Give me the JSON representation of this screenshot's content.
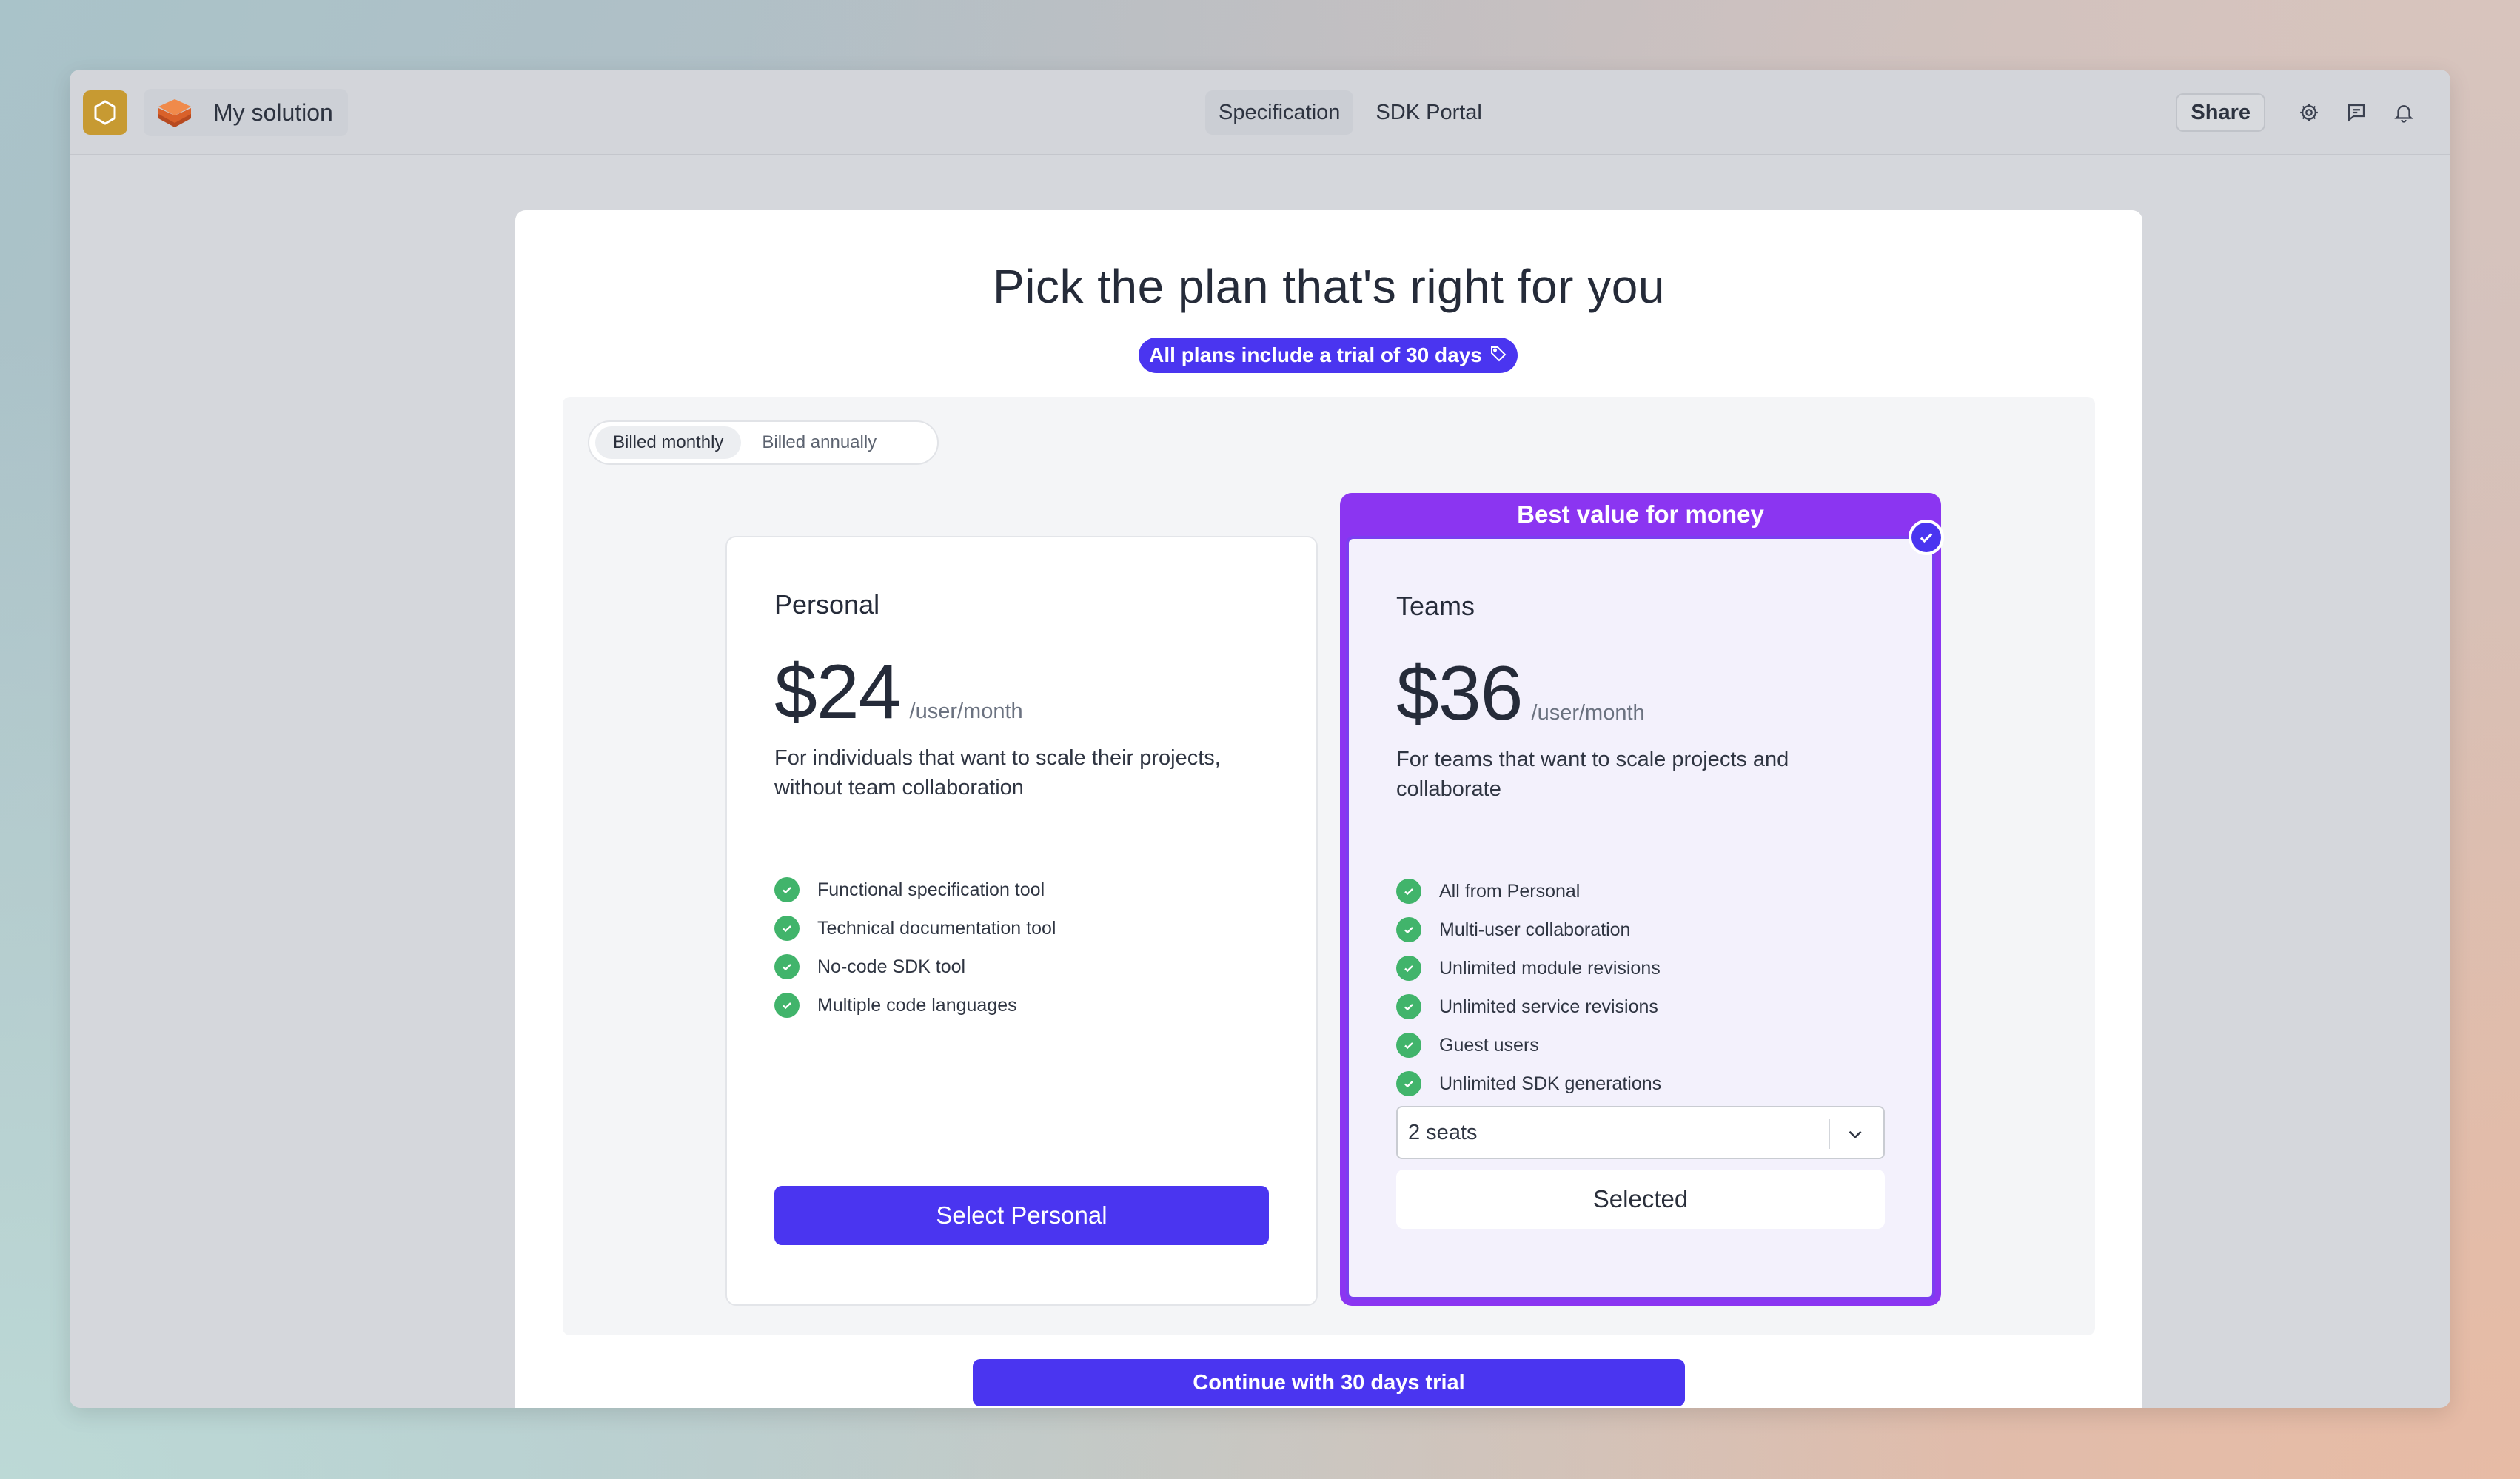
{
  "app": {
    "title": "My solution",
    "icons": {
      "app": "hexagon-icon",
      "logo": "layers-logo-icon"
    }
  },
  "nav": {
    "tabs": [
      {
        "label": "Specification",
        "active": true
      },
      {
        "label": "SDK Portal",
        "active": false
      }
    ]
  },
  "toolbar": {
    "share_label": "Share",
    "icons": [
      "gear-icon",
      "comment-icon",
      "bell-icon"
    ]
  },
  "modal": {
    "title": "Pick the plan that's right for you",
    "trial_badge": "All plans include a trial of 30 days",
    "billing": {
      "options": [
        "Billed monthly",
        "Billed annually"
      ],
      "selected": "Billed monthly"
    },
    "plans": [
      {
        "name": "Personal",
        "price": "$24",
        "period": "/user/month",
        "description": "For individuals that want to scale their projects, without team collaboration",
        "features": [
          "Functional specification tool",
          "Technical documentation tool",
          "No-code SDK tool",
          "Multiple code languages"
        ],
        "button_label": "Select Personal"
      },
      {
        "name": "Teams",
        "price": "$36",
        "period": "/user/month",
        "highlight_label": "Best value for money",
        "description": "For teams that want to scale projects and collaborate",
        "features": [
          "All from Personal",
          "Multi-user collaboration",
          "Unlimited module revisions",
          "Unlimited service revisions",
          "Guest users",
          "Unlimited SDK generations"
        ],
        "seats_value": "2 seats",
        "button_label": "Selected",
        "selected": true
      }
    ],
    "continue_label": "Continue with 30 days trial"
  },
  "colors": {
    "accent": "#4a35f0",
    "highlight": "#8b35f1",
    "success": "#41b46b"
  }
}
